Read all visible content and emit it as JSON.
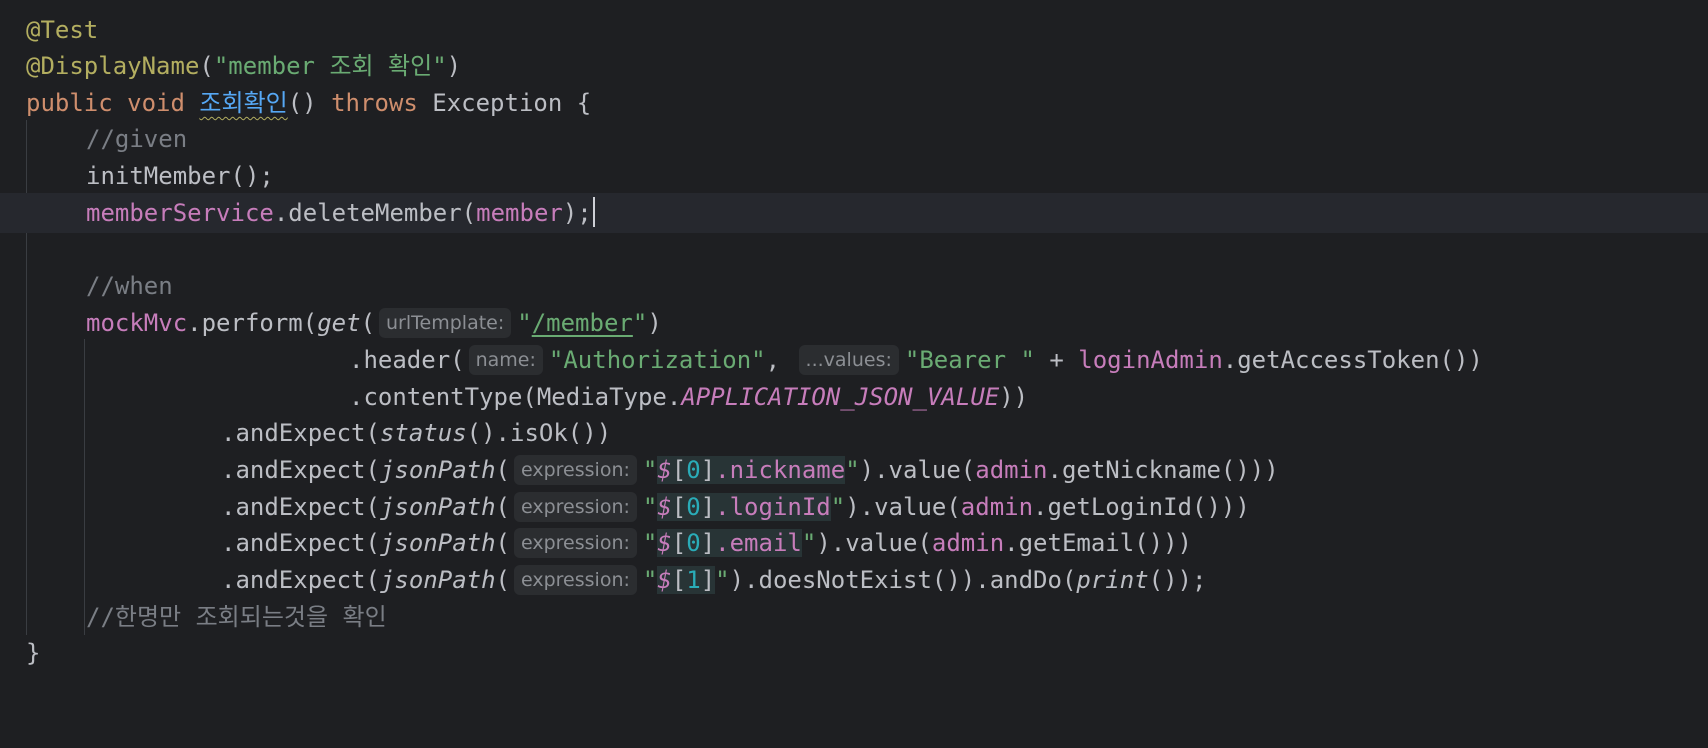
{
  "editor": {
    "lines": {
      "l1": {
        "annotation": "@Test"
      },
      "l2": {
        "annotation": "@DisplayName",
        "open": "(",
        "string": "\"member 조회 확인\"",
        "close": ")"
      },
      "l3": {
        "kw_public": "public",
        "kw_void": "void",
        "method_name": "조회확인",
        "parens": "()",
        "kw_throws": "throws",
        "exception": "Exception {"
      },
      "l4": {
        "comment": "//given"
      },
      "l5": {
        "call": "initMember();"
      },
      "l6": {
        "field": "memberService",
        "dot_call": ".deleteMember(",
        "arg": "member",
        "end": ");"
      },
      "l7": {
        "comment": "//when"
      },
      "l8": {
        "field": "mockMvc",
        "dot_call": ".perform(",
        "fn_get": "get",
        "open": "(",
        "hint": "urlTemplate:",
        "quote_open": "\"",
        "url": "/member",
        "quote_close": "\"",
        "close": ")"
      },
      "l9": {
        "dot_call": ".header(",
        "hint_name": "name:",
        "str_auth": "\"Authorization\"",
        "comma": ",",
        "hint_values": "...values:",
        "str_bearer": "\"Bearer \"",
        "plus": " + ",
        "field": "loginAdmin",
        "call": ".getAccessToken())"
      },
      "l10": {
        "dot_call": ".contentType(MediaType.",
        "const": "APPLICATION_JSON_VALUE",
        "close": "))"
      },
      "l11": {
        "dot_call": ".andExpect(",
        "fn_status": "status",
        "rest": "().isOk())"
      },
      "l12": {
        "dot_call": ".andExpect(",
        "fn_json": "jsonPath",
        "open": "(",
        "hint": "expression:",
        "q1": "\"",
        "root": "$",
        "idx_open": "[",
        "idx": "0",
        "idx_close": "]",
        "prop": ".nickname",
        "q2": "\"",
        "mid": ").value(",
        "field": "admin",
        "rest": ".getNickname()))"
      },
      "l13": {
        "dot_call": ".andExpect(",
        "fn_json": "jsonPath",
        "open": "(",
        "hint": "expression:",
        "q1": "\"",
        "root": "$",
        "idx_open": "[",
        "idx": "0",
        "idx_close": "]",
        "prop": ".loginId",
        "q2": "\"",
        "mid": ").value(",
        "field": "admin",
        "rest": ".getLoginId()))"
      },
      "l14": {
        "dot_call": ".andExpect(",
        "fn_json": "jsonPath",
        "open": "(",
        "hint": "expression:",
        "q1": "\"",
        "root": "$",
        "idx_open": "[",
        "idx": "0",
        "idx_close": "]",
        "prop": ".email",
        "q2": "\"",
        "mid": ").value(",
        "field": "admin",
        "rest": ".getEmail()))"
      },
      "l15": {
        "dot_call": ".andExpect(",
        "fn_json": "jsonPath",
        "open": "(",
        "hint": "expression:",
        "q1": "\"",
        "root": "$",
        "idx_open": "[",
        "idx": "1",
        "idx_close": "]",
        "q2": "\"",
        "mid": ").doesNotExist()).andDo(",
        "fn_print": "print",
        "rest": "());"
      },
      "l16": {
        "comment": "//한명만 조회되는것을 확인"
      },
      "l17": {
        "brace": "}"
      }
    },
    "colors": {
      "background": "#1e1f22",
      "annotation": "#b3ae60",
      "keyword": "#cf8e6d",
      "string": "#6aab73",
      "method_decl": "#56a8f5",
      "field": "#c77dbb",
      "comment": "#7a7e85",
      "number": "#2aacb8"
    }
  }
}
